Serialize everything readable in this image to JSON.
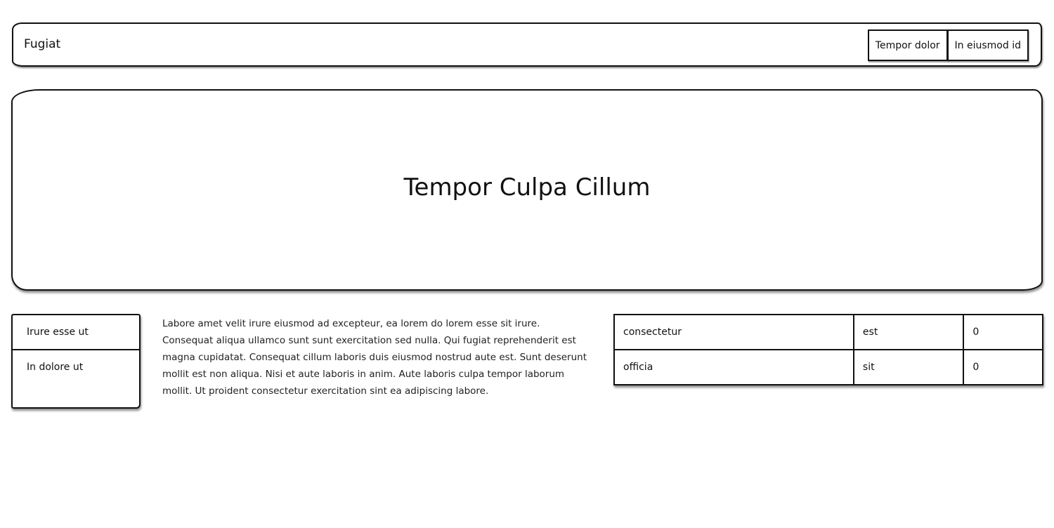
{
  "header": {
    "brand": "Fugiat",
    "nav": [
      {
        "label": "Tempor dolor"
      },
      {
        "label": "In eiusmod id"
      }
    ]
  },
  "hero": {
    "title": "Tempor Culpa Cillum"
  },
  "sidebar": {
    "items": [
      {
        "label": "Irure esse ut"
      },
      {
        "label": "In dolore ut"
      }
    ]
  },
  "content": {
    "paragraph": "Labore amet velit irure eiusmod ad excepteur, ea lorem do lorem esse sit irure. Consequat aliqua ullamco sunt sunt exercitation sed nulla. Qui fugiat reprehenderit est magna cupidatat. Consequat cillum laboris duis eiusmod nostrud aute est. Sunt deserunt mollit est non aliqua. Nisi et aute laboris in anim. Aute laboris culpa tempor laborum mollit. Ut proident consectetur exercitation sint ea adipiscing labore."
  },
  "table": {
    "rows": [
      [
        "consectetur",
        "est",
        "0"
      ],
      [
        "officia",
        "sit",
        "0"
      ]
    ]
  }
}
